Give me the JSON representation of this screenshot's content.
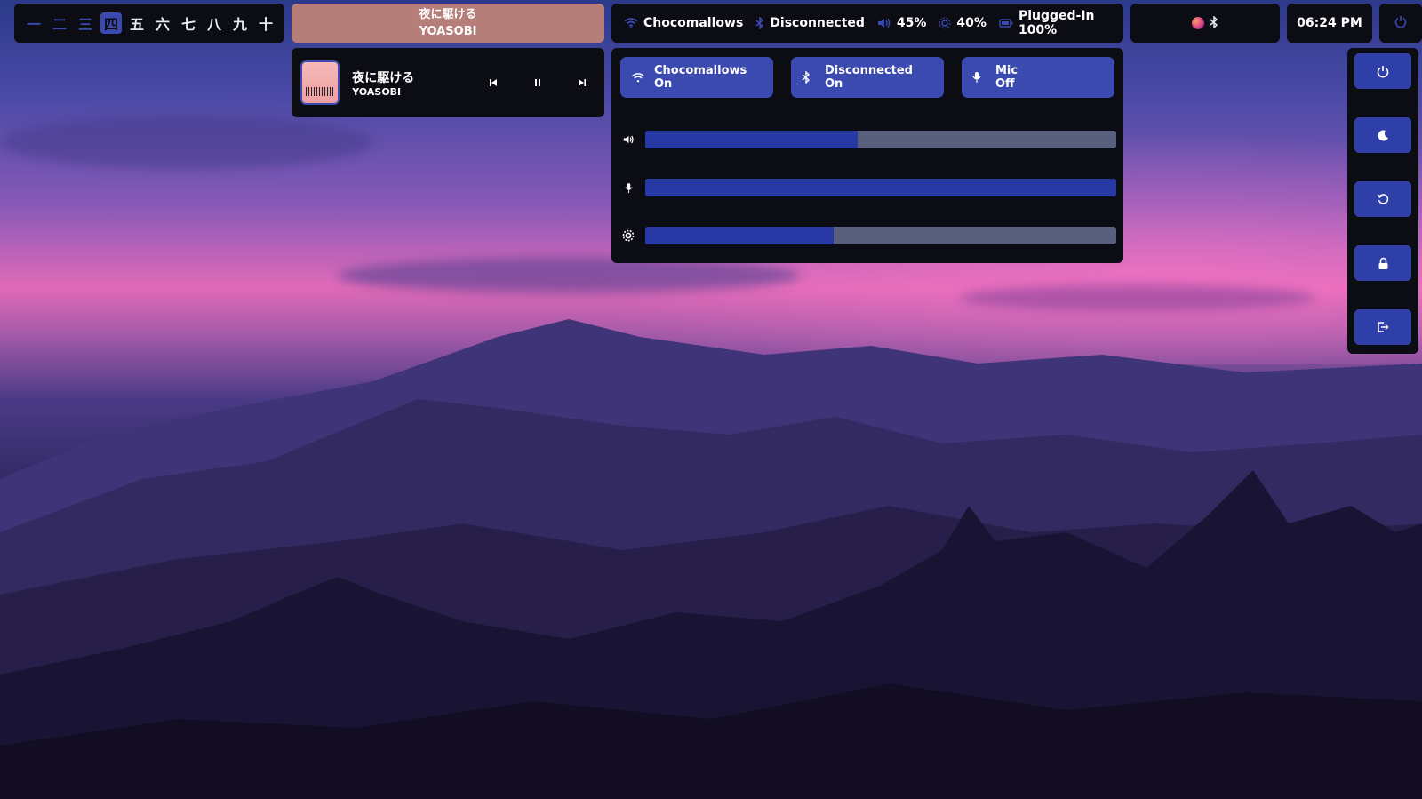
{
  "workspaces": {
    "items": [
      {
        "label": "一",
        "state": "dim"
      },
      {
        "label": "二",
        "state": "dim"
      },
      {
        "label": "三",
        "state": "dim"
      },
      {
        "label": "四",
        "state": "active"
      },
      {
        "label": "五",
        "state": "normal"
      },
      {
        "label": "六",
        "state": "normal"
      },
      {
        "label": "七",
        "state": "normal"
      },
      {
        "label": "八",
        "state": "normal"
      },
      {
        "label": "九",
        "state": "normal"
      },
      {
        "label": "十",
        "state": "normal"
      }
    ]
  },
  "now_playing": {
    "title": "夜に駆ける",
    "artist": "YOASOBI"
  },
  "status_bar": {
    "wifi": "Chocomallows",
    "bluetooth": "Disconnected",
    "volume": "45%",
    "brightness": "40%",
    "battery": "Plugged-In 100%"
  },
  "clock": "06:24 PM",
  "player": {
    "title": "夜に駆ける",
    "artist": "YOASOBI",
    "state": "playing"
  },
  "control_center": {
    "toggles": [
      {
        "name": "Chocomallows",
        "state": "On",
        "icon": "wifi-icon"
      },
      {
        "name": "Disconnected",
        "state": "On",
        "icon": "bluetooth-icon"
      },
      {
        "name": "Mic",
        "state": "Off",
        "icon": "mic-icon"
      }
    ],
    "sliders": {
      "volume": 0.45,
      "microphone": 1.0,
      "brightness": 0.4
    }
  },
  "power_menu": [
    "power-icon",
    "moon-icon",
    "restart-icon",
    "lock-icon",
    "logout-icon"
  ],
  "colors": {
    "accent": "#3a4ab0",
    "panel": "#0b0c14",
    "song_pill": "#b57e78",
    "slider_track": "#58607e"
  }
}
